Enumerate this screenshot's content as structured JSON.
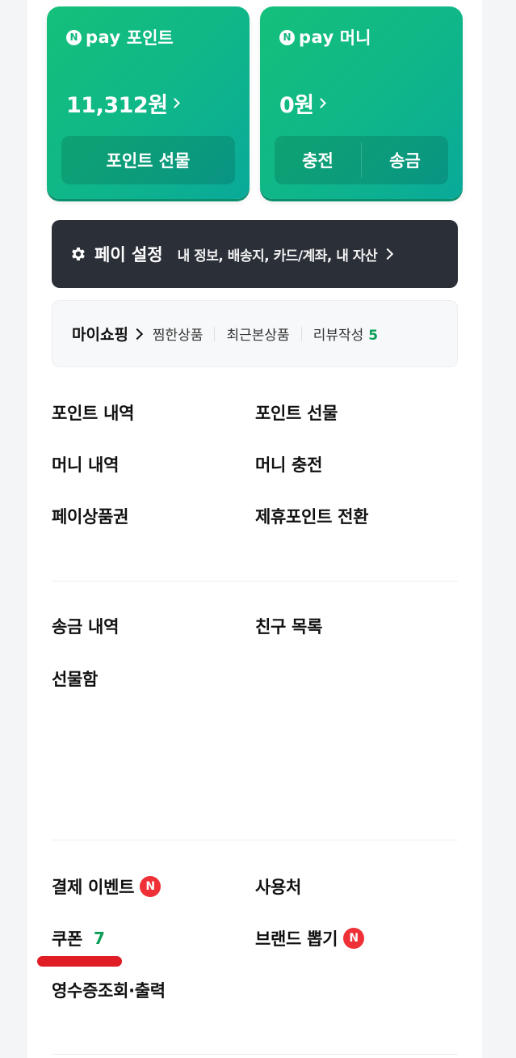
{
  "pay_cards": {
    "point": {
      "badge": "N",
      "brand": "pay",
      "title": "포인트",
      "amount": "11,312원",
      "button": "포인트 선물"
    },
    "money": {
      "badge": "N",
      "brand": "pay",
      "title": "머니",
      "amount": "0원",
      "buttons": [
        "충전",
        "송금"
      ]
    }
  },
  "settings": {
    "title": "페이 설정",
    "subtitle": "내 정보, 배송지, 카드/계좌, 내 자산"
  },
  "myshopping": {
    "title": "마이쇼핑",
    "items": [
      "찜한상품",
      "최근본상품",
      "리뷰작성"
    ],
    "review_count": "5"
  },
  "menu_group_1": [
    "포인트 내역",
    "포인트 선물",
    "머니 내역",
    "머니 충전",
    "페이상품권",
    "제휴포인트 전환"
  ],
  "menu_group_2": [
    "송금 내역",
    "친구 목록",
    "선물함"
  ],
  "menu_group_3": {
    "payment_event": "결제 이벤트",
    "usage_places": "사용처",
    "coupon": "쿠폰",
    "coupon_count": "7",
    "brand_draw": "브랜드 뽑기",
    "receipt": "영수증조회·출력",
    "new_badge": "N"
  },
  "colors": {
    "card_gradient_start": "#14c07a",
    "card_gradient_end": "#0aa99a",
    "settings_bg": "#2b2f38",
    "accent_green": "#0d9f57",
    "new_badge_red": "#ef3036",
    "highlight_underline": "#e01c24"
  }
}
